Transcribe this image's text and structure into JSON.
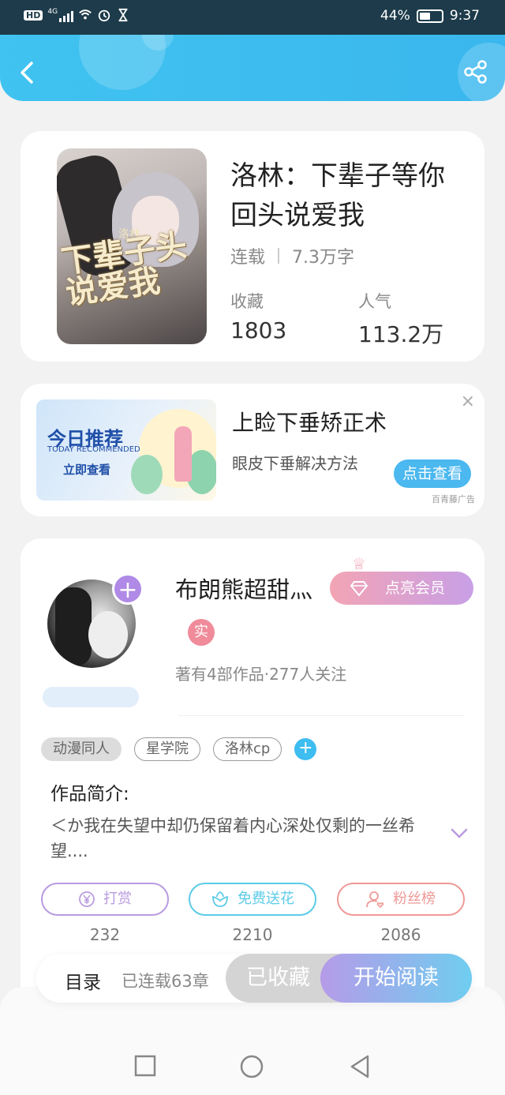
{
  "status_bar": {
    "hd": "HD",
    "signal": "4G",
    "battery_pct_text": "44%",
    "battery_level": 0.44,
    "time": "9:37"
  },
  "header": {
    "back_icon": "chevron-left-icon",
    "share_icon": "share-icon",
    "color": "#3ab7ee"
  },
  "book": {
    "cover_text": "下辈子头说爱我",
    "cover_small": "洛林",
    "title": "洛林：下辈子等你回头说爱我",
    "status": "连载",
    "word_count": "7.3万字",
    "stats": [
      {
        "label": "收藏",
        "value": "1803"
      },
      {
        "label": "人气",
        "value": "113.2万"
      }
    ]
  },
  "ad": {
    "img_title": "今日推荐",
    "img_subtitle": "TODAY RECOMMENDED",
    "img_cta": "立即查看",
    "title": "上睑下垂矫正术",
    "desc": "眼皮下垂解决方法",
    "button": "点击查看",
    "source": "百青藤广告",
    "close": "×"
  },
  "author": {
    "name": "布朗熊超甜灬",
    "vip_button": "点亮会员",
    "real_badge": "实",
    "stats": "著有4部作品·277人关注",
    "tags": [
      "动漫同人",
      "星学院",
      "洛林cp"
    ],
    "intro_label": "作品简介:",
    "intro_text": "＜か我在失望中却仍保留着内心深处仅剩的一丝希望....",
    "actions": [
      {
        "label": "打赏",
        "icon": "yen-coin-icon",
        "count": "232",
        "color": "#b99be0"
      },
      {
        "label": "免费送花",
        "icon": "flower-icon",
        "count": "2210",
        "color": "#5ccbe8"
      },
      {
        "label": "粉丝榜",
        "icon": "fans-ranking-icon",
        "count": "2086",
        "color": "#ef9a97"
      }
    ]
  },
  "bottom_bar": {
    "toc": "目录",
    "serial": "已连载63章",
    "favorited": "已收藏",
    "read": "开始阅读"
  },
  "system_nav": {
    "recent_icon": "square-icon",
    "home_icon": "circle-icon",
    "back_icon": "triangle-back-icon"
  }
}
